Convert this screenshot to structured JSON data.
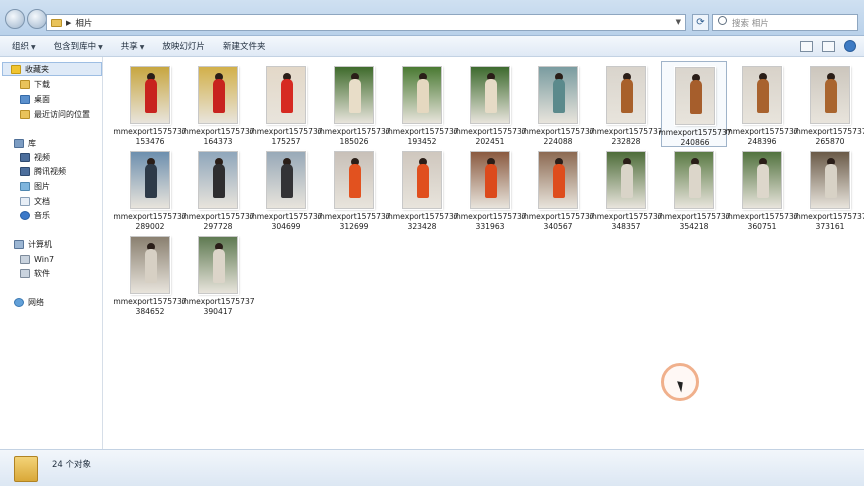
{
  "address": {
    "crumb": "相片",
    "search_placeholder": "搜索 相片"
  },
  "toolbar": {
    "organize": "组织",
    "include_in_library": "包含到库中",
    "share": "共享",
    "slideshow": "放映幻灯片",
    "new_folder": "新建文件夹"
  },
  "sidebar": {
    "items": [
      {
        "label": "收藏夹",
        "icon": "star-icon"
      },
      {
        "label": "下载",
        "icon": "download-folder-icon"
      },
      {
        "label": "桌面",
        "icon": "desktop-icon"
      },
      {
        "label": "最近访问的位置",
        "icon": "recent-places-icon"
      },
      {
        "label": "库",
        "icon": "library-icon"
      },
      {
        "label": "视频",
        "icon": "video-icon"
      },
      {
        "label": "腾讯视频",
        "icon": "video-icon"
      },
      {
        "label": "图片",
        "icon": "pictures-icon"
      },
      {
        "label": "文档",
        "icon": "documents-icon"
      },
      {
        "label": "音乐",
        "icon": "music-icon"
      },
      {
        "label": "计算机",
        "icon": "computer-icon"
      },
      {
        "label": "Win7",
        "icon": "drive-icon"
      },
      {
        "label": "软件",
        "icon": "drive-icon"
      },
      {
        "label": "网络",
        "icon": "network-icon"
      }
    ]
  },
  "files": [
    {
      "name": "mmexport1575737153476",
      "coat": "#c8231e",
      "bg": "#c7a640"
    },
    {
      "name": "mmexport1575737164373",
      "coat": "#c8231e",
      "bg": "#d2b04a"
    },
    {
      "name": "mmexport1575737175257",
      "coat": "#d62a22",
      "bg": "#e3d8c8"
    },
    {
      "name": "mmexport1575737185026",
      "coat": "#e8ddc8",
      "bg": "#3f6b2c"
    },
    {
      "name": "mmexport1575737193452",
      "coat": "#e5d8c0",
      "bg": "#4a7a33"
    },
    {
      "name": "mmexport1575737202451",
      "coat": "#e6dbc6",
      "bg": "#3d6a2e"
    },
    {
      "name": "mmexport1575737224088",
      "coat": "#5b8a8c",
      "bg": "#7a9ca0"
    },
    {
      "name": "mmexport1575737232828",
      "coat": "#a8602a",
      "bg": "#d9d4cc"
    },
    {
      "name": "mmexport1575737240866",
      "coat": "#a65e2c",
      "bg": "#dad5cd"
    },
    {
      "name": "mmexport1575737248396",
      "coat": "#a8622e",
      "bg": "#d8d2c9"
    },
    {
      "name": "mmexport1575737265870",
      "coat": "#a9652f",
      "bg": "#ccc6bd"
    },
    {
      "name": "mmexport1575737289002",
      "coat": "#2d3a48",
      "bg": "#6d8fae"
    },
    {
      "name": "mmexport1575737297728",
      "coat": "#2e2e30",
      "bg": "#8fa6bb"
    },
    {
      "name": "mmexport1575737304699",
      "coat": "#333336",
      "bg": "#98a9b8"
    },
    {
      "name": "mmexport1575737312699",
      "coat": "#e2521f",
      "bg": "#c8c0b8"
    },
    {
      "name": "mmexport1575737323428",
      "coat": "#e04f1e",
      "bg": "#cfc7be"
    },
    {
      "name": "mmexport1575737331963",
      "coat": "#dc4a1c",
      "bg": "#8a5a40"
    },
    {
      "name": "mmexport1575737340567",
      "coat": "#de4d1d",
      "bg": "#8c6a52"
    },
    {
      "name": "mmexport1575737348357",
      "coat": "#d9d4c8",
      "bg": "#4e6d3a"
    },
    {
      "name": "mmexport1575737354218",
      "coat": "#dcd6ca",
      "bg": "#5a7a44"
    },
    {
      "name": "mmexport1575737360751",
      "coat": "#ddd7cb",
      "bg": "#52733f"
    },
    {
      "name": "mmexport1575737373161",
      "coat": "#d8d2c6",
      "bg": "#6a5a48"
    },
    {
      "name": "mmexport1575737384652",
      "coat": "#d7d0c4",
      "bg": "#8a8070"
    },
    {
      "name": "mmexport1575737390417",
      "coat": "#dcd5c9",
      "bg": "#5f7a52"
    }
  ],
  "status": {
    "count_text": "24 个对象"
  }
}
